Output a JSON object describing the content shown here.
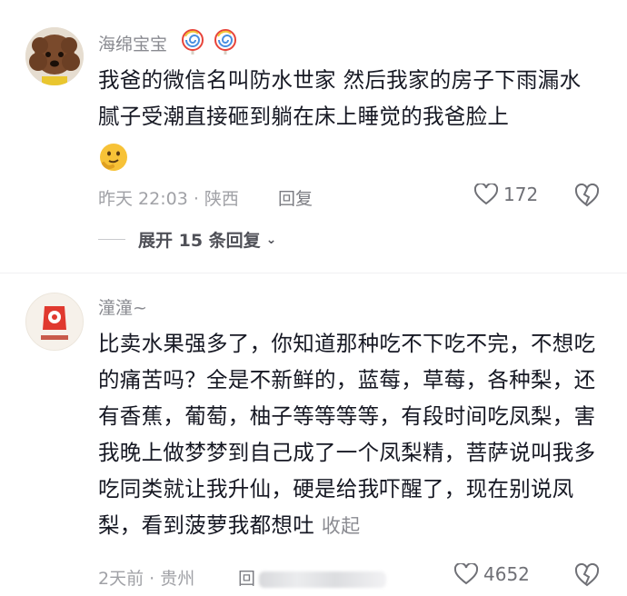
{
  "comments": [
    {
      "username": "海绵宝宝",
      "text": "我爸的微信名叫防水世家 然后我家的房子下雨漏水腻子受潮直接砸到躺在床上睡觉的我爸脸上",
      "meta": "昨天 22:03 · 陕西",
      "reply_label": "回复",
      "likes": "172",
      "expand_label": "展开 15 条回复"
    },
    {
      "username": "潼潼~",
      "text": "比卖水果强多了，你知道那种吃不下吃不完，不想吃的痛苦吗？全是不新鲜的，蓝莓，草莓，各种梨，还有香蕉，葡萄，柚子等等等等，有段时间吃凤梨，害我晚上做梦梦到自己成了一个凤梨精，菩萨说叫我多吃同类就让我升仙，硬是给我吓醒了，现在别说凤梨，看到菠萝我都想吐",
      "collapse_label": "收起",
      "meta": "2天前 · 贵州",
      "reply_label": "回",
      "likes": "4652"
    }
  ],
  "colors": {
    "text": "#161823",
    "secondary": "#8a8b91",
    "lolli_red": "#e8443a",
    "lolli_blue": "#4a8fe0"
  }
}
